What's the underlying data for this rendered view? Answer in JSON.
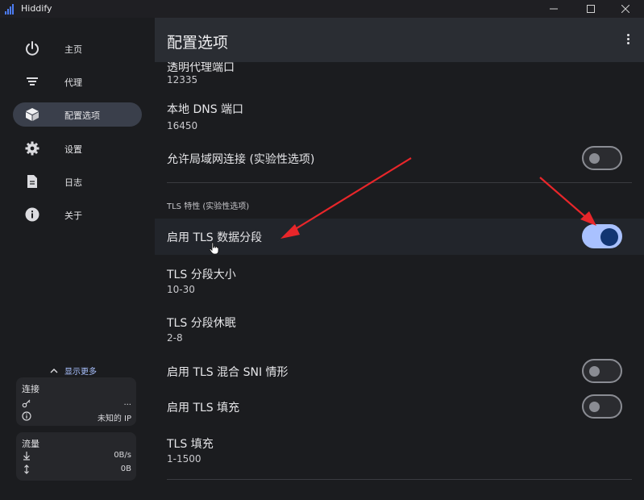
{
  "window": {
    "title": "Hiddify",
    "minimize_icon": "minimize-icon",
    "maximize_icon": "maximize-icon",
    "close_icon": "close-icon"
  },
  "sidebar": {
    "items": [
      {
        "label": "主页",
        "icon": "power-icon"
      },
      {
        "label": "代理",
        "icon": "filter-list-icon"
      },
      {
        "label": "配置选项",
        "icon": "box-icon",
        "active": true
      },
      {
        "label": "设置",
        "icon": "gear-icon"
      },
      {
        "label": "日志",
        "icon": "document-icon"
      },
      {
        "label": "关于",
        "icon": "info-icon"
      }
    ],
    "show_more": "显示更多",
    "connection": {
      "title": "连接",
      "link_value": "...",
      "ip_value": "未知的 IP"
    },
    "traffic": {
      "title": "流量",
      "download": "0B/s",
      "total": "0B"
    }
  },
  "header": {
    "title": "配置选项"
  },
  "settings": {
    "transparent_proxy": {
      "title": "透明代理端口",
      "value": "12335"
    },
    "local_dns": {
      "title": "本地 DNS 端口",
      "value": "16450"
    },
    "allow_lan": {
      "title": "允许局域网连接 (实验性选项)",
      "enabled": false
    },
    "tls_section": "TLS 特性 (实验性选项)",
    "tls_fragment": {
      "title": "启用 TLS 数据分段",
      "enabled": true
    },
    "tls_fragment_size": {
      "title": "TLS 分段大小",
      "value": "10-30"
    },
    "tls_fragment_sleep": {
      "title": "TLS 分段休眠",
      "value": "2-8"
    },
    "tls_mixed_sni": {
      "title": "启用 TLS 混合 SNI 情形",
      "enabled": false
    },
    "tls_padding": {
      "title": "启用 TLS 填充",
      "enabled": false
    },
    "tls_padding_size": {
      "title": "TLS 填充",
      "value": "1-1500"
    }
  },
  "colors": {
    "accent": "#a9c1ff",
    "switch_knob_on": "#123572",
    "annotation_arrow": "#e8262a"
  }
}
